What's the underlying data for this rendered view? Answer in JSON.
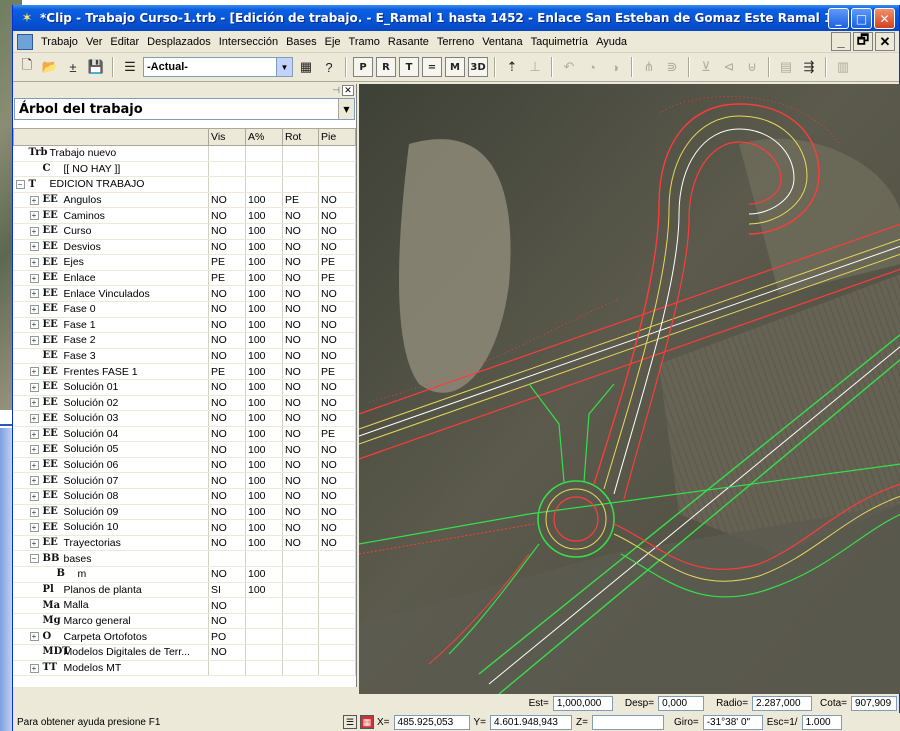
{
  "window": {
    "title": "*Clip - Trabajo Curso-1.trb - [Edición de trabajo. - E_Ramal 1 hasta 1452 - Enlace San Esteban de Gomaz Este Ramal 1]"
  },
  "menu": {
    "items": [
      "Trabajo",
      "Ver",
      "Editar",
      "Desplazados",
      "Intersección",
      "Bases",
      "Eje",
      "Tramo",
      "Rasante",
      "Terreno",
      "Ventana",
      "Taquimetría",
      "Ayuda"
    ]
  },
  "toolbar": {
    "layer_combo": "-Actual-",
    "view_buttons": [
      "P",
      "R",
      "T",
      "=",
      "M",
      "3D"
    ]
  },
  "panel": {
    "title": "Árbol del trabajo",
    "columns": [
      "",
      "Vis",
      "A%",
      "Rot",
      "Pie"
    ],
    "rows": [
      {
        "indent": 0,
        "exp": "",
        "icon": "Trb",
        "name": "Trabajo nuevo",
        "vis": "",
        "a": "",
        "rot": "",
        "pie": ""
      },
      {
        "indent": 1,
        "exp": "",
        "icon": "C",
        "name": "[[ NO HAY ]]",
        "vis": "",
        "a": "",
        "rot": "",
        "pie": ""
      },
      {
        "indent": 0,
        "exp": "−",
        "icon": "T",
        "name": "EDICION TRABAJO",
        "vis": "",
        "a": "",
        "rot": "",
        "pie": ""
      },
      {
        "indent": 1,
        "exp": "+",
        "icon": "EE",
        "name": "Angulos",
        "vis": "NO",
        "a": "100",
        "rot": "PE",
        "pie": "NO"
      },
      {
        "indent": 1,
        "exp": "+",
        "icon": "EE",
        "name": "Caminos",
        "vis": "NO",
        "a": "100",
        "rot": "NO",
        "pie": "NO"
      },
      {
        "indent": 1,
        "exp": "+",
        "icon": "EE",
        "name": "Curso",
        "vis": "NO",
        "a": "100",
        "rot": "NO",
        "pie": "NO"
      },
      {
        "indent": 1,
        "exp": "+",
        "icon": "EE",
        "name": "Desvios",
        "vis": "NO",
        "a": "100",
        "rot": "NO",
        "pie": "NO"
      },
      {
        "indent": 1,
        "exp": "+",
        "icon": "EE",
        "name": "Ejes",
        "vis": "PE",
        "a": "100",
        "rot": "NO",
        "pie": "PE"
      },
      {
        "indent": 1,
        "exp": "+",
        "icon": "EE",
        "name": "Enlace",
        "vis": "PE",
        "a": "100",
        "rot": "NO",
        "pie": "PE"
      },
      {
        "indent": 1,
        "exp": "+",
        "icon": "EE",
        "name": "Enlace Vinculados",
        "vis": "NO",
        "a": "100",
        "rot": "NO",
        "pie": "NO"
      },
      {
        "indent": 1,
        "exp": "+",
        "icon": "EE",
        "name": "Fase 0",
        "vis": "NO",
        "a": "100",
        "rot": "NO",
        "pie": "NO"
      },
      {
        "indent": 1,
        "exp": "+",
        "icon": "EE",
        "name": "Fase 1",
        "vis": "NO",
        "a": "100",
        "rot": "NO",
        "pie": "NO"
      },
      {
        "indent": 1,
        "exp": "+",
        "icon": "EE",
        "name": "Fase 2",
        "vis": "NO",
        "a": "100",
        "rot": "NO",
        "pie": "NO"
      },
      {
        "indent": 1,
        "exp": "",
        "icon": "EE",
        "name": "Fase 3",
        "vis": "NO",
        "a": "100",
        "rot": "NO",
        "pie": "NO"
      },
      {
        "indent": 1,
        "exp": "+",
        "icon": "EE",
        "name": "Frentes FASE 1",
        "vis": "PE",
        "a": "100",
        "rot": "NO",
        "pie": "PE"
      },
      {
        "indent": 1,
        "exp": "+",
        "icon": "EE",
        "name": "Solución 01",
        "vis": "NO",
        "a": "100",
        "rot": "NO",
        "pie": "NO"
      },
      {
        "indent": 1,
        "exp": "+",
        "icon": "EE",
        "name": "Solución 02",
        "vis": "NO",
        "a": "100",
        "rot": "NO",
        "pie": "NO"
      },
      {
        "indent": 1,
        "exp": "+",
        "icon": "EE",
        "name": "Solución 03",
        "vis": "NO",
        "a": "100",
        "rot": "NO",
        "pie": "NO"
      },
      {
        "indent": 1,
        "exp": "+",
        "icon": "EE",
        "name": "Solución 04",
        "vis": "NO",
        "a": "100",
        "rot": "NO",
        "pie": "PE"
      },
      {
        "indent": 1,
        "exp": "+",
        "icon": "EE",
        "name": "Solución 05",
        "vis": "NO",
        "a": "100",
        "rot": "NO",
        "pie": "NO"
      },
      {
        "indent": 1,
        "exp": "+",
        "icon": "EE",
        "name": "Solución 06",
        "vis": "NO",
        "a": "100",
        "rot": "NO",
        "pie": "NO"
      },
      {
        "indent": 1,
        "exp": "+",
        "icon": "EE",
        "name": "Solución 07",
        "vis": "NO",
        "a": "100",
        "rot": "NO",
        "pie": "NO"
      },
      {
        "indent": 1,
        "exp": "+",
        "icon": "EE",
        "name": "Solución 08",
        "vis": "NO",
        "a": "100",
        "rot": "NO",
        "pie": "NO"
      },
      {
        "indent": 1,
        "exp": "+",
        "icon": "EE",
        "name": "Solución 09",
        "vis": "NO",
        "a": "100",
        "rot": "NO",
        "pie": "NO"
      },
      {
        "indent": 1,
        "exp": "+",
        "icon": "EE",
        "name": "Solución 10",
        "vis": "NO",
        "a": "100",
        "rot": "NO",
        "pie": "NO"
      },
      {
        "indent": 1,
        "exp": "+",
        "icon": "EE",
        "name": "Trayectorias",
        "vis": "NO",
        "a": "100",
        "rot": "NO",
        "pie": "NO"
      },
      {
        "indent": 1,
        "exp": "−",
        "icon": "BB",
        "name": "bases",
        "vis": "",
        "a": "",
        "rot": "",
        "pie": ""
      },
      {
        "indent": 2,
        "exp": "",
        "icon": "B",
        "name": "m",
        "vis": "NO",
        "a": "100",
        "rot": "",
        "pie": ""
      },
      {
        "indent": 1,
        "exp": "",
        "icon": "Pl",
        "name": "Planos de planta",
        "vis": "SI",
        "a": "100",
        "rot": "",
        "pie": ""
      },
      {
        "indent": 1,
        "exp": "",
        "icon": "Ma",
        "name": "Malla",
        "vis": "NO",
        "a": "",
        "rot": "",
        "pie": ""
      },
      {
        "indent": 1,
        "exp": "",
        "icon": "Mg",
        "name": "Marco general",
        "vis": "NO",
        "a": "",
        "rot": "",
        "pie": ""
      },
      {
        "indent": 1,
        "exp": "+",
        "icon": "O",
        "name": "Carpeta Ortofotos",
        "vis": "PO",
        "a": "",
        "rot": "",
        "pie": ""
      },
      {
        "indent": 1,
        "exp": "",
        "icon": "MDT",
        "name": "Modelos Digitales de Terr...",
        "vis": "NO",
        "a": "",
        "rot": "",
        "pie": ""
      },
      {
        "indent": 1,
        "exp": "+",
        "icon": "TT",
        "name": "Modelos MT",
        "vis": "",
        "a": "",
        "rot": "",
        "pie": ""
      }
    ]
  },
  "coords": {
    "est_label": "Est=",
    "est": "1,000,000",
    "desp_label": "Desp=",
    "desp": "0,000",
    "radio_label": "Radio=",
    "radio": "2.287,000",
    "cota_label": "Cota=",
    "cota": "907,909"
  },
  "status": {
    "help": "Para obtener ayuda presione F1",
    "x_label": "X=",
    "x": "485.925,053",
    "y_label": "Y=",
    "y": "4.601.948,943",
    "z_label": "Z=",
    "z": "",
    "giro_label": "Giro=",
    "giro": "-31°38' 0\"",
    "esc_label": "Esc=1/",
    "esc": "1.000"
  },
  "colors": {
    "titlebar": "#0654d6",
    "road_red": "#ff3b3b",
    "road_green": "#35e04a",
    "road_yellow": "#e8d85a",
    "axis_white": "#ffffff"
  }
}
